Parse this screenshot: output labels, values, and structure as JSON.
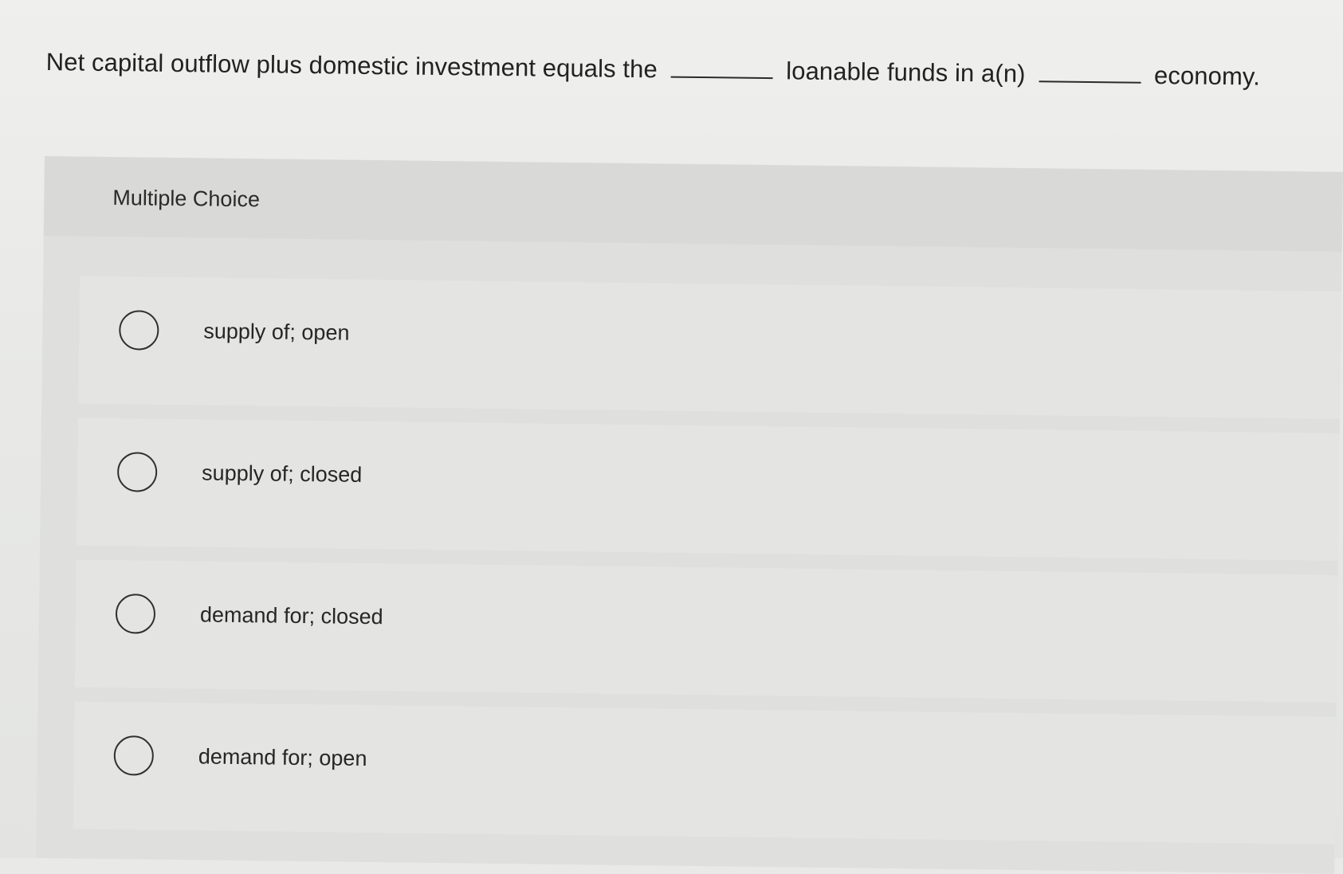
{
  "question": {
    "part1": "Net capital outflow plus domestic investment equals the",
    "part2": "loanable funds in a(n)",
    "part3": "economy."
  },
  "panel": {
    "title": "Multiple Choice"
  },
  "options": [
    {
      "label": "supply of; open"
    },
    {
      "label": "supply of; closed"
    },
    {
      "label": "demand for; closed"
    },
    {
      "label": "demand for; open"
    }
  ]
}
